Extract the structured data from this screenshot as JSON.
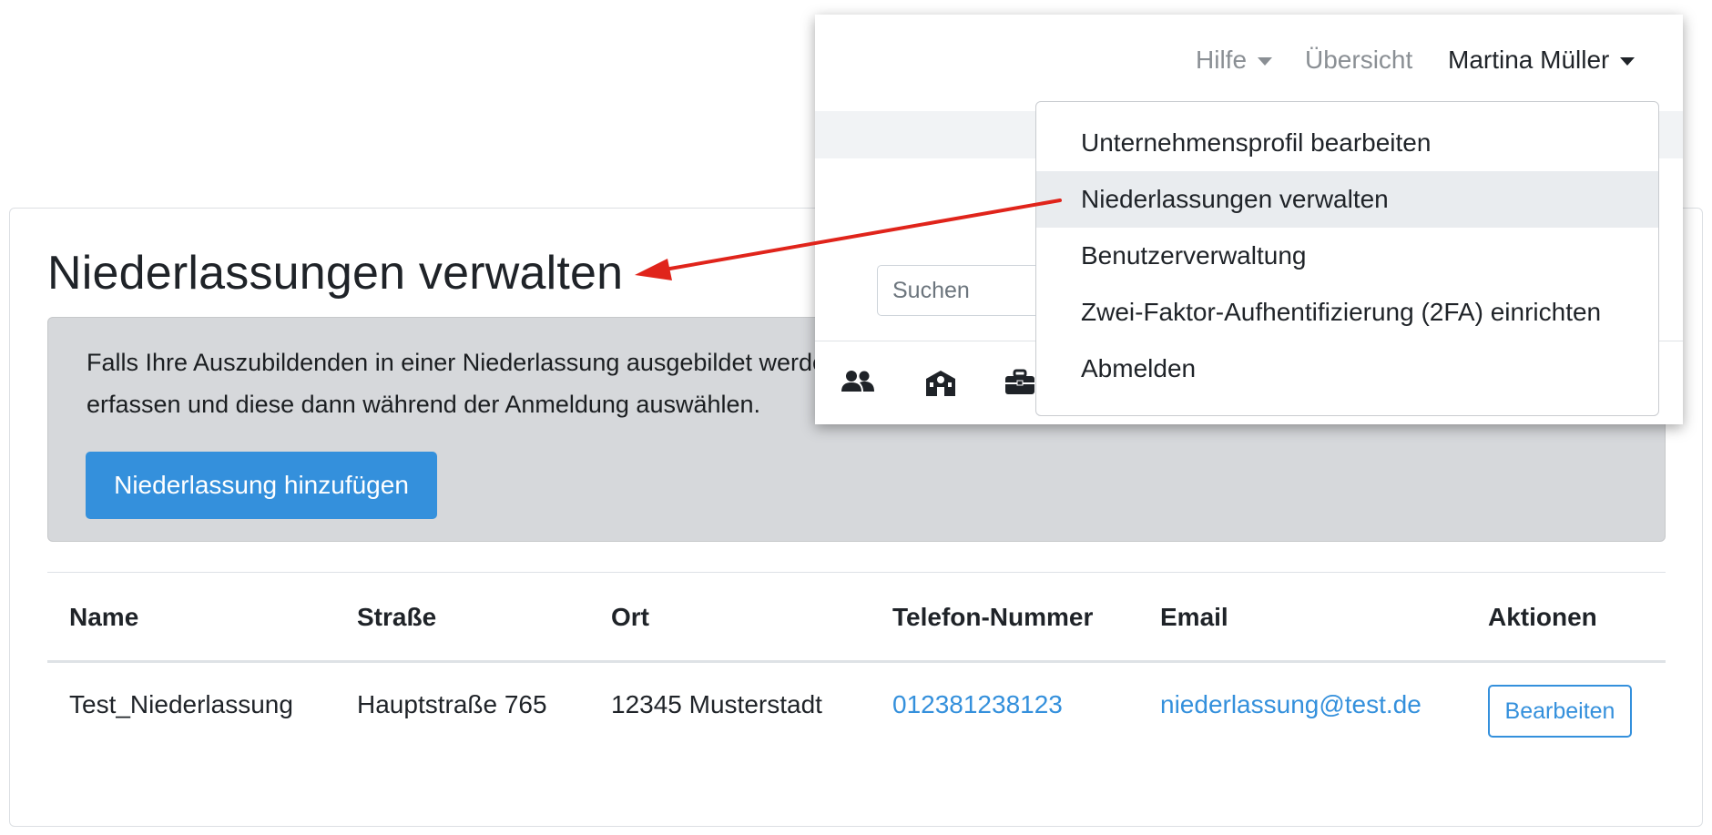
{
  "page": {
    "title": "Niederlassungen verwalten",
    "info_text_line1": "Falls Ihre Auszubildenden in einer Niederlassung ausgebildet werden",
    "info_text_line2": "erfassen und diese dann während der Anmeldung auswählen.",
    "add_button": "Niederlassung hinzufügen"
  },
  "table": {
    "headers": [
      "Name",
      "Straße",
      "Ort",
      "Telefon-Nummer",
      "Email",
      "Aktionen"
    ],
    "rows": [
      {
        "name": "Test_Niederlassung",
        "street": "Hauptstraße 765",
        "city": "12345 Musterstadt",
        "phone": "012381238123",
        "email": "niederlassung@test.de",
        "action": "Bearbeiten"
      }
    ]
  },
  "navbar": {
    "help": "Hilfe",
    "overview": "Übersicht",
    "user": "Martina Müller"
  },
  "search": {
    "placeholder": "Suchen"
  },
  "icon_bar": [
    "users-icon",
    "school-icon",
    "briefcase-icon"
  ],
  "dropdown": {
    "items": [
      "Unternehmensprofil bearbeiten",
      "Niederlassungen verwalten",
      "Benutzerverwaltung",
      "Zwei-Faktor-Aufhentifizierung (2FA) einrichten",
      "Abmelden"
    ],
    "active_index": 1
  },
  "colors": {
    "primary": "#3490dc",
    "info_bg": "#d6d8db",
    "annotation_arrow": "#e0241b"
  }
}
